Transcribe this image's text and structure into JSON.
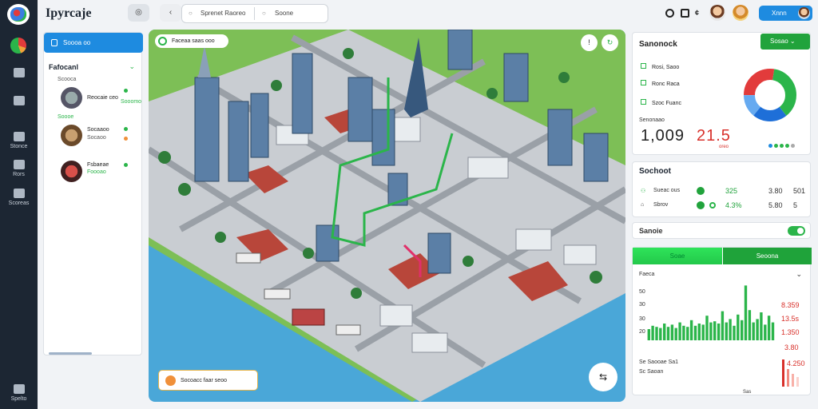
{
  "app": {
    "title": "Ipyrcaje"
  },
  "topbar": {
    "search_placeholder_1": "Sprenet Raoreo",
    "search_placeholder_2": "Soone",
    "user_label": "Xnnn"
  },
  "rail": {
    "items": [
      {
        "label": "Stonce",
        "icon": "recycle-icon"
      },
      {
        "label": "Rors",
        "icon": "camera-icon"
      },
      {
        "label": "Scoreas",
        "icon": "people-icon"
      },
      {
        "label": "Spelto",
        "icon": "home-icon"
      }
    ]
  },
  "left_panel": {
    "button_label": "Soooa oo",
    "section_title": "Fafocanl",
    "subheading": "Scooca",
    "items": [
      {
        "title": "Reocaie ceo",
        "subtitle": "Sooomo",
        "dot_color": "#2bb54a"
      },
      {
        "title": "Socaaoo",
        "subtitle": "Socaoo",
        "dot_color": "#2bb54a"
      },
      {
        "title": "Fsbaeae",
        "subtitle": "Foooao",
        "dot_color": "#2bb54a"
      }
    ],
    "second_sub": "Soooe"
  },
  "map": {
    "chip_label": "Faceaa saas ooo",
    "footer_label": "Socoacc faar seoo",
    "button_1": "!",
    "button_2": "↻"
  },
  "stats_card": {
    "title": "Sanonock",
    "button_label": "Sosao",
    "legend": [
      "Rosi, Saoo",
      "Ronc Raca",
      "Szoc Fuanc"
    ],
    "note": "Senonaao",
    "value_1": "1,009",
    "value_2": "21.5",
    "value_2_sub": "oreo",
    "pie_colors": [
      "#e23b3b",
      "#2bb54a",
      "#1e6fd8",
      "#66aaf0"
    ]
  },
  "status_card": {
    "title": "Sochoot",
    "rows": [
      {
        "label": "Sueac ous",
        "value_a": "325",
        "value_b": "3.80",
        "value_c": "501"
      },
      {
        "label": "Sbrov",
        "value_a": "4.3%",
        "value_b": "5.80",
        "value_c": "5"
      }
    ]
  },
  "toggle_card": {
    "label": "Sanoie"
  },
  "chart_card": {
    "tab_1": "Soae",
    "tab_2": "Seoona",
    "header_label": "Faeca",
    "y_ticks": [
      "50",
      "30",
      "30",
      "20"
    ],
    "right_values": [
      "8.359",
      "13.5s",
      "1.350",
      "3.80"
    ],
    "footer_labels": [
      "Se Saooae Sa1",
      "Sc Saoan"
    ],
    "footer_value": "4.250",
    "axis_label": "Sas"
  },
  "chart_data": {
    "type": "bar",
    "series": [
      {
        "values": [
          1,
          1.3,
          1.2,
          1.1,
          1.5,
          1.2,
          1.4,
          1.1,
          1.6,
          1.3,
          1.2,
          1.8,
          1.3,
          1.5,
          1.4,
          2.2,
          1.6,
          1.7,
          1.5,
          2.6,
          1.6,
          1.9,
          1.3,
          2.3,
          1.8,
          4.9,
          2.7,
          1.6,
          1.9,
          2.5,
          1.4,
          2.2,
          1.6
        ]
      }
    ]
  }
}
